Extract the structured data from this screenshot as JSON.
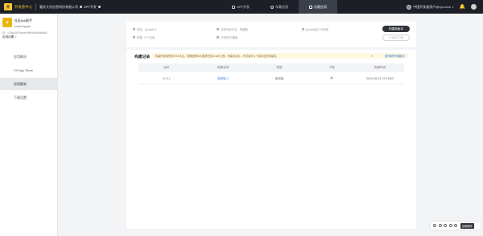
{
  "topbar": {
    "logo_text": "开",
    "brand": "开发者中心",
    "company": "重庆大东信息科技有限公司",
    "company_tag": "APP开发",
    "nav": [
      {
        "label": "APP开发",
        "active": false
      },
      {
        "label": "车载应用",
        "active": false
      },
      {
        "label": "包裹应用",
        "active": true
      }
    ],
    "user_email": "中国开发者用户@xyz.com",
    "accent": "#f4c430",
    "bg": "#1c1f26"
  },
  "sidebar": {
    "app_name": "社区tick助手",
    "app_sub": "pubcbulguper",
    "app_id": "ID：c78da3b70ecfa4b9b9fa4b8c6d8a4",
    "switch_label": "应用设置 >",
    "items": [
      {
        "label": "应用概况",
        "active": false
      },
      {
        "label": "XX App Store",
        "active": false
      },
      {
        "label": "应用版本",
        "active": true
      },
      {
        "label": "下载设置",
        "active": false
      }
    ]
  },
  "top_card": {
    "info": [
      {
        "label": "项目：pkosta2.2"
      },
      {
        "label": "当前代码分支：构建版"
      },
      {
        "label": "pkosta运行 已安装"
      },
      {
        "label": "构建（7个应用"
      },
      {
        "label": "已完成 构建版"
      }
    ],
    "primary_button": "构建新版本",
    "secondary_button": "已添加工程"
  },
  "main_card": {
    "section_title": "构建记录",
    "notice": "构建所使用的是2013平台，需要按照SDK要求完成Xcode工程，构建成功后，开发者可以下载对应的构建包。",
    "notice_close": "✕",
    "notice_link": "如何制作构建包？",
    "table": {
      "headers": [
        "版本",
        "构建名称",
        "类型",
        "下载",
        "构建时间"
      ],
      "rows": [
        {
          "version": "v1.0.1",
          "file": "测试包-1",
          "type": "测试版",
          "download": "✕",
          "time": "2024-08-21 22:18:50"
        }
      ]
    }
  },
  "fab": {
    "label": "自助服务"
  }
}
